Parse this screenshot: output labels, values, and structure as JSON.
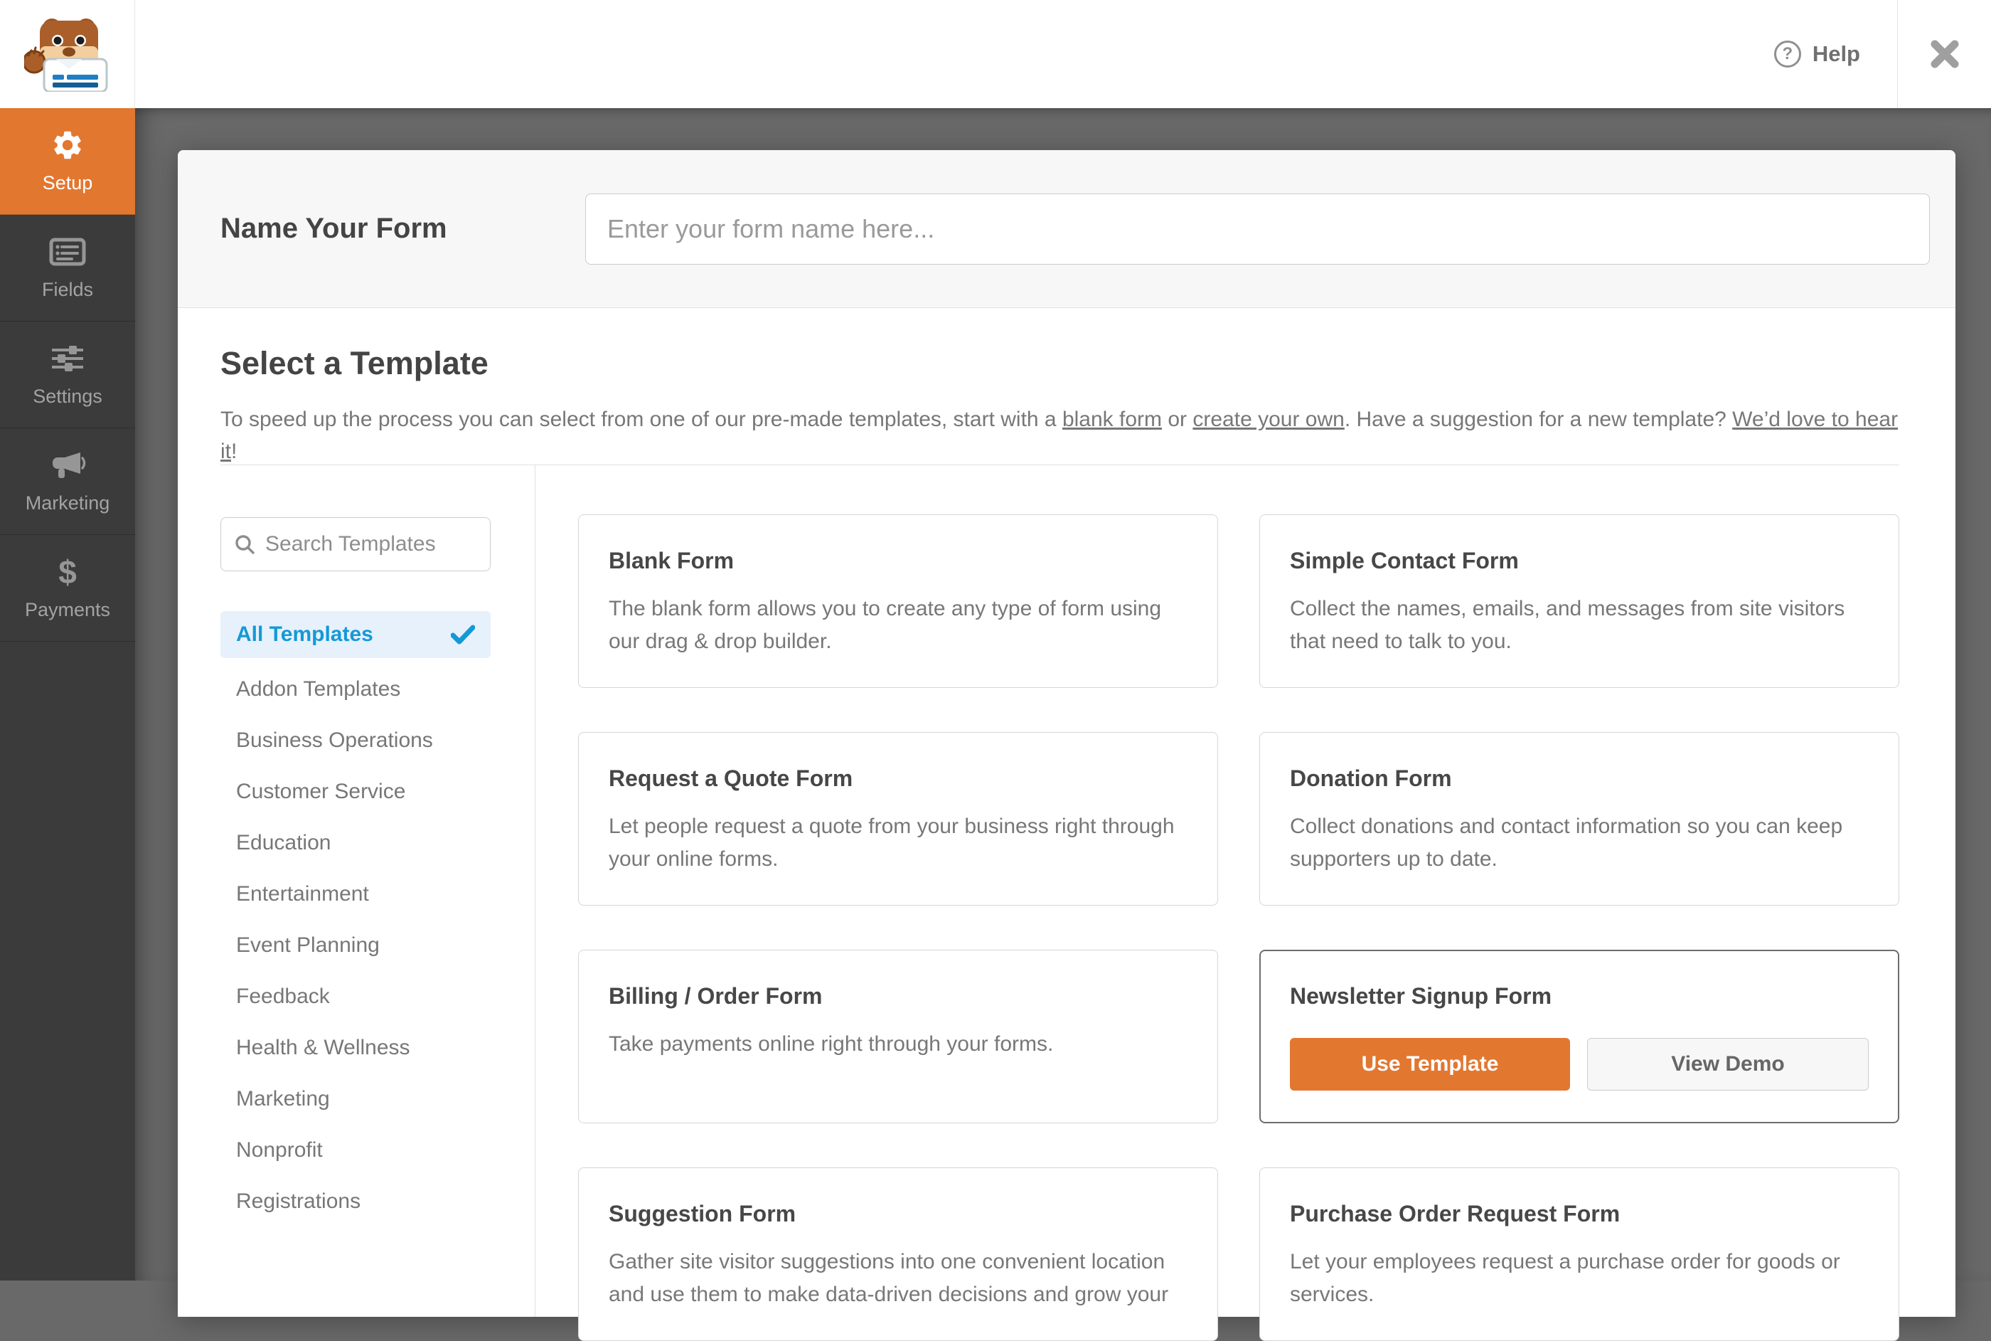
{
  "header": {
    "help_label": "Help",
    "help_glyph": "?"
  },
  "sidebar": {
    "items": [
      {
        "label": "Setup"
      },
      {
        "label": "Fields"
      },
      {
        "label": "Settings"
      },
      {
        "label": "Marketing"
      },
      {
        "label": "Payments"
      }
    ],
    "payments_glyph": "$"
  },
  "form_name": {
    "title": "Name Your Form",
    "placeholder": "Enter your form name here..."
  },
  "template_section": {
    "title": "Select a Template",
    "intro": {
      "p1": "To speed up the process you can select from one of our pre-made templates, start with a ",
      "link_blank": "blank form",
      "p2": " or ",
      "link_create": "create your own",
      "p3": ". Have a suggestion for a new template? ",
      "link_suggest": "We’d love to hear it",
      "p4": "!"
    }
  },
  "search": {
    "placeholder": "Search Templates"
  },
  "categories": {
    "selected": "All Templates",
    "items": [
      "Addon Templates",
      "Business Operations",
      "Customer Service",
      "Education",
      "Entertainment",
      "Event Planning",
      "Feedback",
      "Health & Wellness",
      "Marketing",
      "Nonprofit",
      "Registrations"
    ]
  },
  "templates": [
    {
      "name": "Blank Form",
      "description": "The blank form allows you to create any type of form using our drag & drop builder."
    },
    {
      "name": "Simple Contact Form",
      "description": "Collect the names, emails, and messages from site visitors that need to talk to you."
    },
    {
      "name": "Request a Quote Form",
      "description": "Let people request a quote from your business right through your online forms."
    },
    {
      "name": "Donation Form",
      "description": "Collect donations and contact information so you can keep supporters up to date."
    },
    {
      "name": "Billing / Order Form",
      "description": "Take payments online right through your forms."
    },
    {
      "name": "Newsletter Signup Form",
      "use_template_label": "Use Template",
      "view_demo_label": "View Demo"
    },
    {
      "name": "Suggestion Form",
      "description": "Gather site visitor suggestions into one convenient location and use them to make data-driven decisions and grow your"
    },
    {
      "name": "Purchase Order Request Form",
      "description": "Let your employees request a purchase order for goods or services."
    }
  ],
  "colors": {
    "accent_orange": "#e27730",
    "selected_blue": "#1499d8",
    "selected_blue_bg": "#e7f1fb",
    "sidebar_bg": "#3b3b3b",
    "overlay_bg": "#696969"
  }
}
